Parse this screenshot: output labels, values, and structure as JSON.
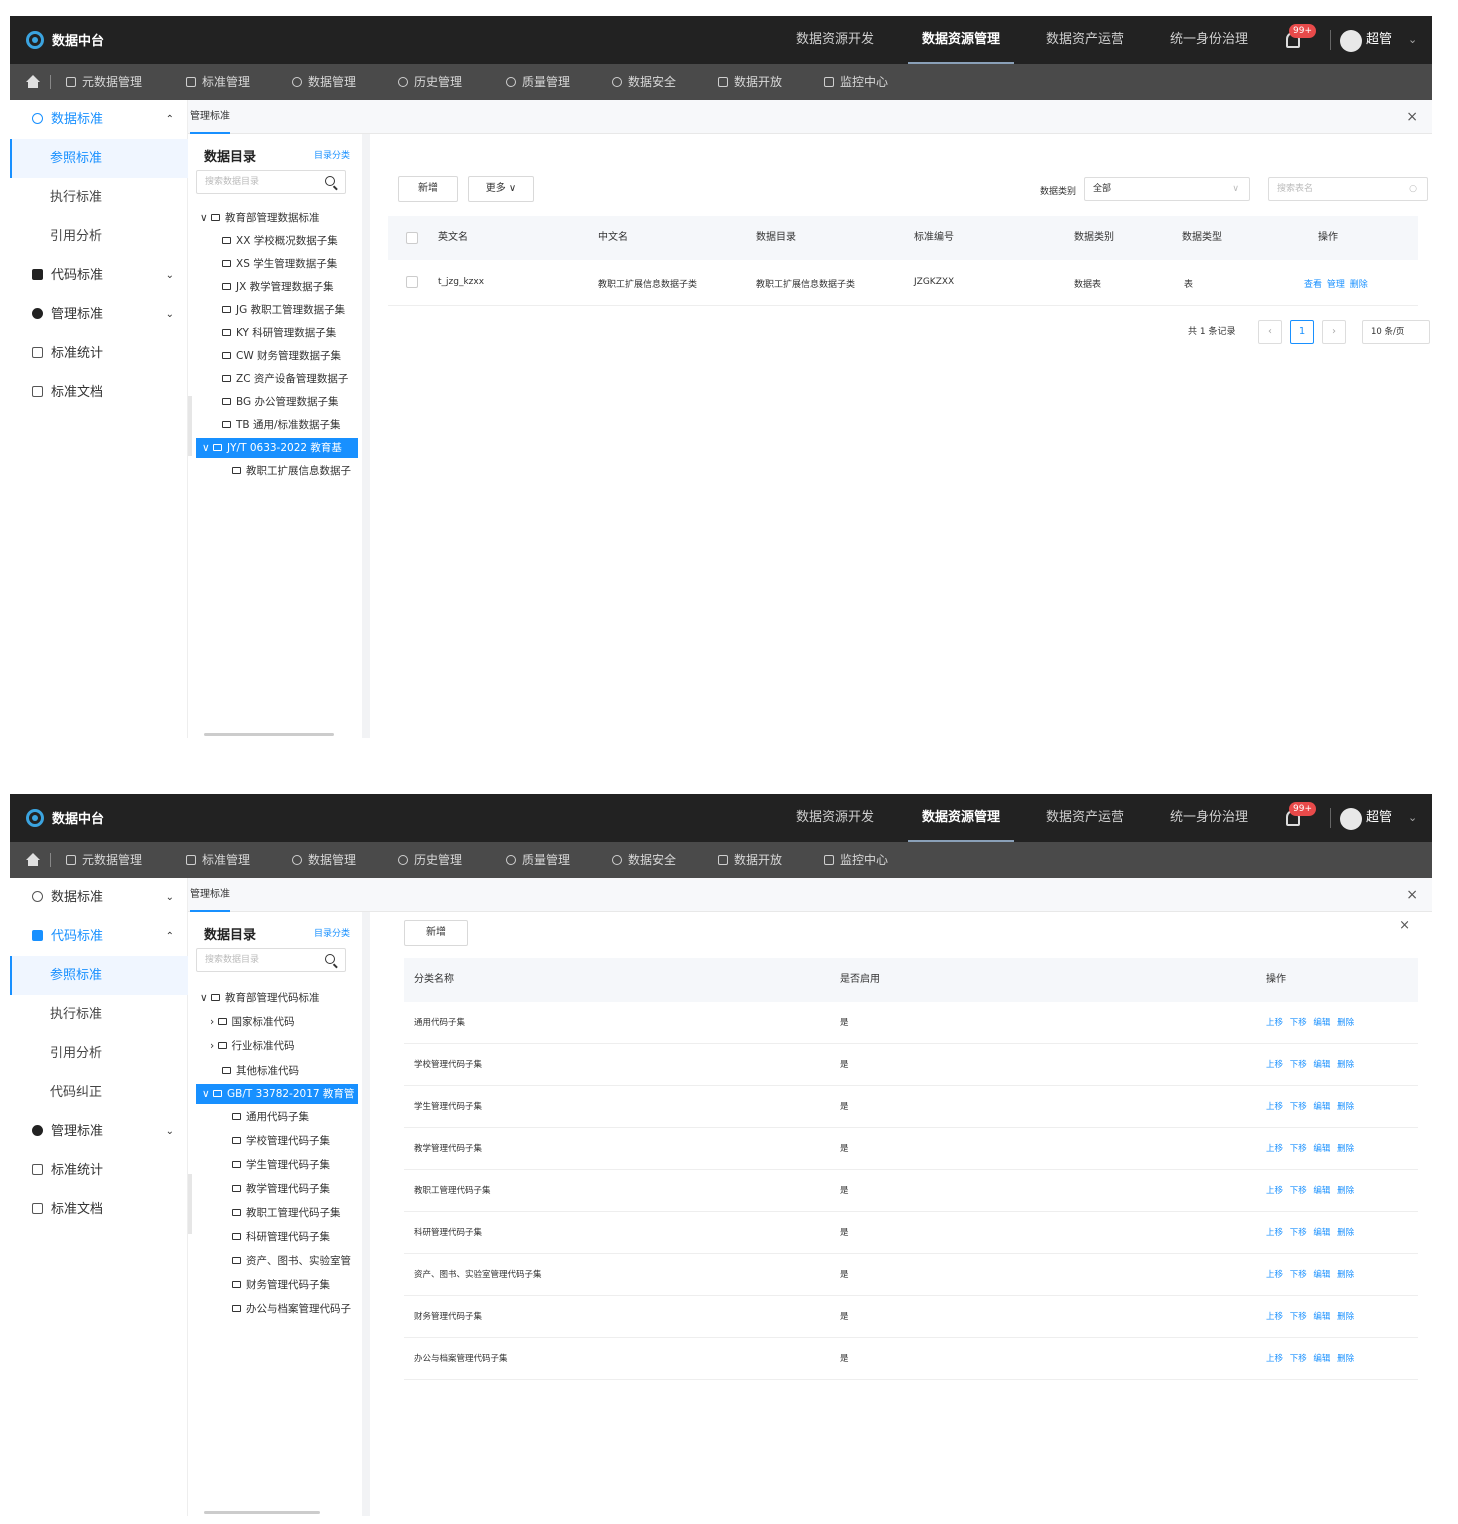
{
  "app": {
    "title": "数据中台"
  },
  "top_nav": [
    "数据资源开发",
    "数据资源管理",
    "数据资产运营",
    "统一身份治理"
  ],
  "top_nav_active": "数据资源管理",
  "notification_badge": "99+",
  "user": {
    "name": "超管"
  },
  "sub_nav": [
    "元数据管理",
    "标准管理",
    "数据管理",
    "历史管理",
    "质量管理",
    "数据安全",
    "数据开放",
    "监控中心"
  ],
  "colors": {
    "topbar": "#222222",
    "subbar": "#4a4a4a",
    "accent": "#1890ff",
    "badge": "#e84a4a"
  },
  "screen1": {
    "sidebar": [
      {
        "label": "数据标准",
        "icon": "database-icon",
        "expanded": true
      },
      {
        "label": "参照标准",
        "selected": true
      },
      {
        "label": "执行标准"
      },
      {
        "label": "引用分析"
      },
      {
        "label": "代码标准",
        "icon": "code-icon"
      },
      {
        "label": "管理标准",
        "icon": "manage-icon"
      },
      {
        "label": "标准统计",
        "icon": "stats-icon"
      },
      {
        "label": "标准文档",
        "icon": "doc-icon"
      }
    ],
    "tab": "管理标准",
    "tree": {
      "title": "数据目录",
      "category_link": "目录分类",
      "search_placeholder": "搜索数据目录",
      "root": "教育部管理数据标准",
      "children": [
        "XX 学校概况数据子集",
        "XS 学生管理数据子集",
        "JX 教学管理数据子集",
        "JG 教职工管理数据子集",
        "KY 科研管理数据子集",
        "CW 财务管理数据子集",
        "ZC 资产设备管理数据子",
        "BG 办公管理数据子集",
        "TB 通用/标准数据子集"
      ],
      "selected": "JY/T 0633-2022 教育基",
      "selected_child": "教职工扩展信息数据子"
    },
    "toolbar": {
      "add": "新增",
      "more": "更多"
    },
    "filter": {
      "label": "数据类别",
      "value": "全部",
      "search_placeholder": "搜索表名"
    },
    "table": {
      "headers": [
        "英文名",
        "中文名",
        "数据目录",
        "标准编号",
        "数据类别",
        "数据类型",
        "操作"
      ],
      "rows": [
        {
          "en": "t_jzg_kzxx",
          "cn": "教职工扩展信息数据子类",
          "dir": "教职工扩展信息数据子类",
          "code": "JZGKZXX",
          "category": "数据表",
          "type": "表",
          "actions": "查看 管理 删除"
        }
      ]
    },
    "pager": {
      "total": "共 1 条记录",
      "page": "1",
      "size": "10 条/页"
    }
  },
  "screen2": {
    "sidebar": [
      {
        "label": "数据标准",
        "icon": "database-icon"
      },
      {
        "label": "代码标准",
        "icon": "code-icon",
        "expanded": true
      },
      {
        "label": "参照标准",
        "selected": true
      },
      {
        "label": "执行标准"
      },
      {
        "label": "引用分析"
      },
      {
        "label": "代码纠正"
      },
      {
        "label": "管理标准",
        "icon": "manage-icon"
      },
      {
        "label": "标准统计",
        "icon": "stats-icon"
      },
      {
        "label": "标准文档",
        "icon": "doc-icon"
      }
    ],
    "tab": "管理标准",
    "tree": {
      "title": "数据目录",
      "category_link": "目录分类",
      "search_placeholder": "搜索数据目录",
      "root": "教育部管理代码标准",
      "groups": [
        "国家标准代码",
        "行业标准代码",
        "其他标准代码"
      ],
      "selected": "GB/T 33782-2017 教育管",
      "children": [
        "通用代码子集",
        "学校管理代码子集",
        "学生管理代码子集",
        "教学管理代码子集",
        "教职工管理代码子集",
        "科研管理代码子集",
        "资产、图书、实验室管",
        "财务管理代码子集",
        "办公与档案管理代码子"
      ]
    },
    "toolbar": {
      "add": "新增"
    },
    "table": {
      "headers": [
        "分类名称",
        "是否启用",
        "操作"
      ],
      "rows": [
        {
          "name": "通用代码子集",
          "enabled": "是",
          "actions": "上移 下移 编辑 删除"
        },
        {
          "name": "学校管理代码子集",
          "enabled": "是",
          "actions": "上移 下移 编辑 删除"
        },
        {
          "name": "学生管理代码子集",
          "enabled": "是",
          "actions": "上移 下移 编辑 删除"
        },
        {
          "name": "教学管理代码子集",
          "enabled": "是",
          "actions": "上移 下移 编辑 删除"
        },
        {
          "name": "教职工管理代码子集",
          "enabled": "是",
          "actions": "上移 下移 编辑 删除"
        },
        {
          "name": "科研管理代码子集",
          "enabled": "是",
          "actions": "上移 下移 编辑 删除"
        },
        {
          "name": "资产、图书、实验室管理代码子集",
          "enabled": "是",
          "actions": "上移 下移 编辑 删除"
        },
        {
          "name": "财务管理代码子集",
          "enabled": "是",
          "actions": "上移 下移 编辑 删除"
        },
        {
          "name": "办公与档案管理代码子集",
          "enabled": "是",
          "actions": "上移 下移 编辑 删除"
        }
      ]
    }
  }
}
